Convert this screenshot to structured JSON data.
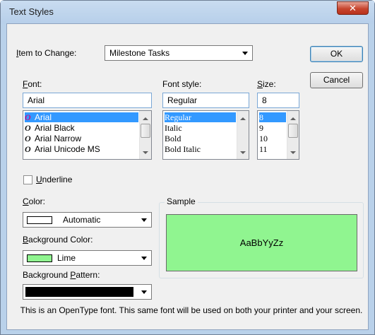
{
  "window": {
    "title": "Text Styles",
    "close_glyph": "✕"
  },
  "item_to_change": {
    "label_u": "I",
    "label_rest": "tem to Change:",
    "value": "Milestone Tasks"
  },
  "buttons": {
    "ok": "OK",
    "cancel": "Cancel"
  },
  "font": {
    "label_u": "F",
    "label_rest": "ont:",
    "value": "Arial",
    "items": [
      "Arial",
      "Arial Black",
      "Arial Narrow",
      "Arial Unicode MS"
    ],
    "selected_index": 0
  },
  "font_style": {
    "label": "Font style:",
    "value": "Regular",
    "items": [
      "Regular",
      "Italic",
      "Bold",
      "Bold Italic"
    ],
    "selected_index": 0
  },
  "size": {
    "label_u": "S",
    "label_rest": "ize:",
    "value": "8",
    "items": [
      "8",
      "9",
      "10",
      "11"
    ],
    "selected_index": 0
  },
  "underline": {
    "label_u": "U",
    "label_rest": "nderline",
    "checked": false
  },
  "color": {
    "label_u": "C",
    "label_rest": "olor:",
    "value": "Automatic",
    "swatch": "#ffffff"
  },
  "background_color": {
    "label_u": "B",
    "label_rest": "ackground Color:",
    "value": "Lime",
    "swatch": "#90f590"
  },
  "background_pattern": {
    "label_pre": "Background ",
    "label_u": "P",
    "label_rest": "attern:",
    "swatch": "#000000"
  },
  "sample": {
    "label": "Sample",
    "text": "AaBbYyZz",
    "background": "#90f590"
  },
  "info_text": "This is an OpenType font. This same font will be used on both your printer and your screen."
}
